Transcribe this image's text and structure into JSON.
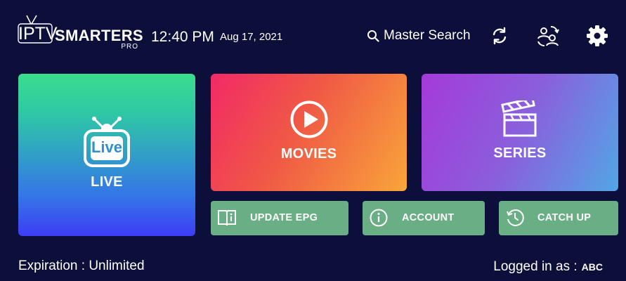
{
  "header": {
    "logo": {
      "left": "IPTV",
      "right": "SMARTERS",
      "sub": "PRO"
    },
    "time": "12:40 PM",
    "date": "Aug 17, 2021",
    "search_label": "Master Search",
    "icons": [
      "search-icon",
      "refresh-icon",
      "switch-user-icon",
      "gear-icon"
    ]
  },
  "tiles": {
    "live": {
      "label": "LIVE",
      "icon_text": "Live"
    },
    "movies": {
      "label": "MOVIES"
    },
    "series": {
      "label": "SERIES"
    }
  },
  "buttons": {
    "update_epg": "UPDATE EPG",
    "account": "ACCOUNT",
    "catch_up": "CATCH UP"
  },
  "footer": {
    "expiration": "Expiration : Unlimited",
    "logged_in_label": "Logged in as :",
    "username": "ABC"
  },
  "colors": {
    "background": "#0b0f3a",
    "button_green": "#6aae86"
  }
}
